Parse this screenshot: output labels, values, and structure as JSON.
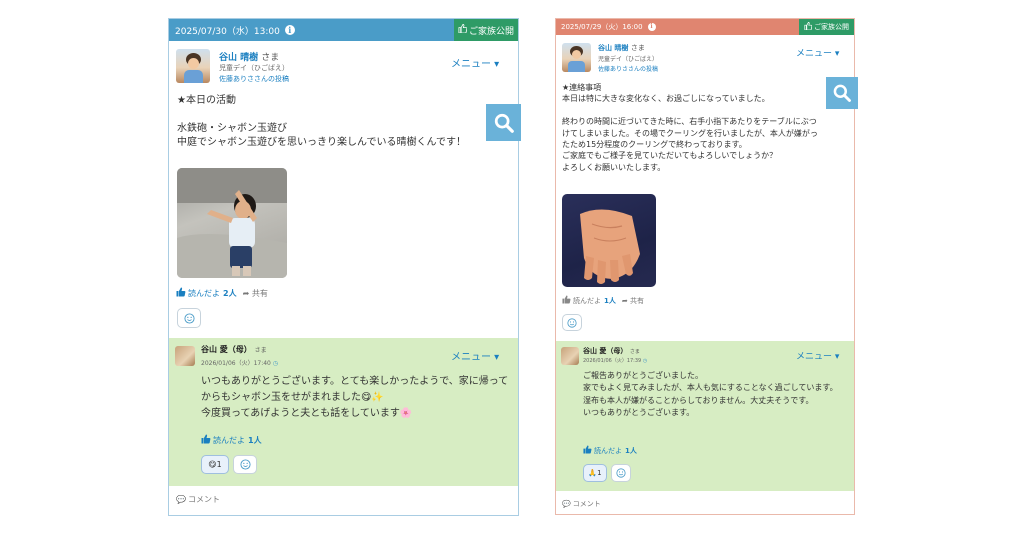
{
  "posts": [
    {
      "date": "2025/07/30（水）13:00",
      "badge": "ご家族公開",
      "author": "谷山 晴樹",
      "honorific": "さま",
      "service": "児童デイ（ひごばえ）",
      "poster": "佐藤ありささんの投稿",
      "menu": "メニュー ▾",
      "body": "★本日の活動\n\n水鉄砲・シャボン玉遊び\n中庭でシャボン玉遊びを思いっきり楽しんでいる晴樹くんです！",
      "read_label": "読んだよ",
      "read_count": "2人",
      "share_label": "共有",
      "reply": {
        "author": "谷山 愛（母）",
        "honorific": "さま",
        "date": "2026/01/06（火）17:40",
        "menu": "メニュー ▾",
        "body": "いつもありがとうございます。とても楽しかったようで、家に帰ってからもシャボン玉をせがまれました😋✨\n今度買ってあげようと夫とも話をしています🌸",
        "read_label": "読んだよ",
        "read_count": "1人",
        "reaction": "😋1"
      },
      "comment_label": "コメント"
    },
    {
      "date": "2025/07/29（火）16:00",
      "badge": "ご家族公開",
      "author": "谷山 晴樹",
      "honorific": "さま",
      "service": "児童デイ（ひごばえ）",
      "poster": "佐藤ありささんの投稿",
      "menu": "メニュー ▾",
      "body": "★連絡事項\n本日は特に大きな変化なく、お過ごしになっていました。\n\n終わりの時間に近づいてきた時に、右手小指下あたりをテーブルにぶつけてしまいました。その場でクーリングを行いましたが、本人が嫌がったため15分程度のクーリングで終わっております。\nご家庭でもご様子を見ていただいてもよろしいでしょうか？\nよろしくお願いいたします。",
      "read_label": "読んだよ",
      "read_count": "1人",
      "share_label": "共有",
      "reply": {
        "author": "谷山 愛（母）",
        "honorific": "さま",
        "date": "2026/01/06（火）17:39",
        "menu": "メニュー ▾",
        "body": "ご報告ありがとうございました。\n家でもよく見てみましたが、本人も気にすることなく過ごしています。\n湿布も本人が嫌がることからしておりません。大丈夫そうです。\nいつもありがとうございます。",
        "read_label": "読んだよ",
        "read_count": "1人",
        "reaction": "🙏1"
      },
      "comment_label": "コメント"
    }
  ],
  "icons": {
    "search": "search-icon",
    "info": "info-icon",
    "thumbs_up": "thumbs-up-icon",
    "share": "share-icon",
    "smiley": "smiley-icon",
    "comment": "comment-icon"
  },
  "colors": {
    "left_header": "#4a9cc8",
    "right_header": "#e08570",
    "family_badge": "#2e9b66",
    "reply_bg": "#d7edc3",
    "link": "#1a7fc0",
    "search_button": "#6ab2d9"
  }
}
